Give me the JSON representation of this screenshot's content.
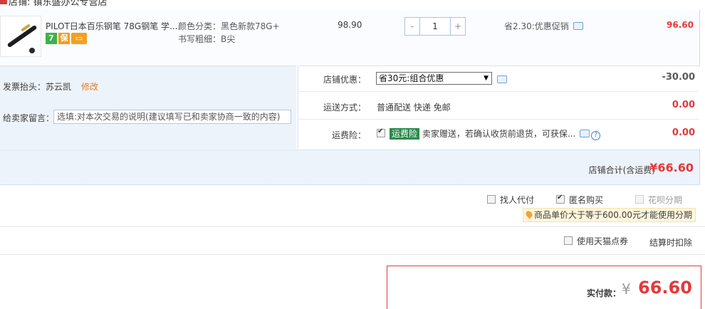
{
  "shop": {
    "name": "店铺: 镇东盛办公专营店"
  },
  "item": {
    "title": "PILOT日本百乐钢笔 78G钢笔 学...",
    "sku_color": "颜色分类：黑色新款78G+",
    "sku_nib": "书写粗细：B尖",
    "unit_price": "98.90",
    "qty_minus": "-",
    "qty_value": "1",
    "qty_plus": "+",
    "promo": "省2.30:优惠促销",
    "line_total": "96.60",
    "badges": {
      "seven_day": "7",
      "guarantee": "保",
      "card": "▭"
    }
  },
  "invoice": {
    "label": "发票抬头：",
    "name": "苏云凯",
    "edit": "修改"
  },
  "message": {
    "label": "给卖家留言：",
    "placeholder": "选填:对本次交易的说明(建议填写已和卖家协商一致的内容)"
  },
  "shop_discount": {
    "label": "店铺优惠：",
    "selected": "省30元:组合优惠",
    "amount": "-30.00"
  },
  "shipping": {
    "label": "运送方式：",
    "value": "普通配送 快递 免邮",
    "amount": "0.00"
  },
  "insurance": {
    "label": "运费险：",
    "tag": "运费险",
    "desc": "卖家赠送，若确认收货前退货，可获保...",
    "amount": "0.00"
  },
  "shop_total": {
    "label": "店铺合计(含运费)",
    "value": "¥66.60"
  },
  "options": {
    "proxy_pay": "找人代付",
    "anonymous": "匿名购买",
    "huabei": "花呗分期",
    "huabei_tip": "商品单价大于等于600.00元才能使用分期",
    "tmall_points": "使用天猫点券",
    "points_note": "结算时扣除"
  },
  "payment": {
    "label": "实付款：",
    "currency": "¥",
    "value": "66.60"
  },
  "colors": {
    "price_red": "#e4393c",
    "panel_blue": "#edf3fa",
    "border_blue": "#a7c4e6"
  }
}
